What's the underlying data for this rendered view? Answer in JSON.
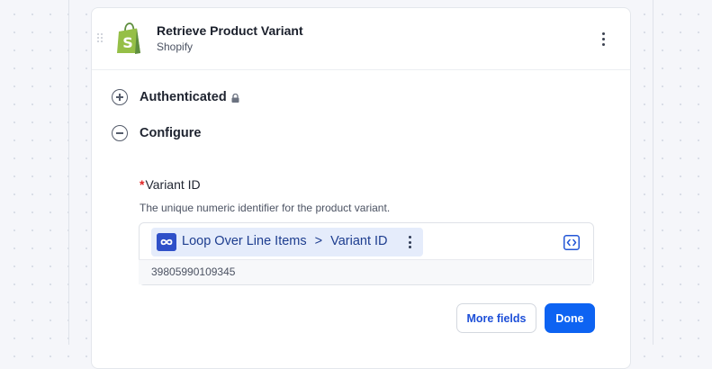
{
  "node": {
    "title": "Retrieve Product Variant",
    "app": "Shopify",
    "logo_icon": "shopify-bag-icon",
    "brand_color": "#95bf47"
  },
  "sections": [
    {
      "label": "Authenticated",
      "state": "collapsed",
      "icon": "plus-circle-icon",
      "badge_icon": "lock-icon"
    },
    {
      "label": "Configure",
      "state": "expanded",
      "icon": "minus-circle-icon"
    }
  ],
  "field": {
    "required_marker": "*",
    "label": "Variant ID",
    "description": "The unique numeric identifier for the product variant.",
    "mapping": {
      "source": "Loop Over Line Items",
      "separator": ">",
      "path": "Variant ID",
      "icon": "loop-icon"
    },
    "toggle_icon": "code-toggle-icon",
    "preview_value": "39805990109345"
  },
  "actions": {
    "more_fields_label": "More fields",
    "done_label": "Done"
  },
  "colors": {
    "accent": "#0d63f2",
    "chip_bg": "#e5ecfb",
    "chip_icon_bg": "#2f50c8",
    "required": "#e02424"
  }
}
